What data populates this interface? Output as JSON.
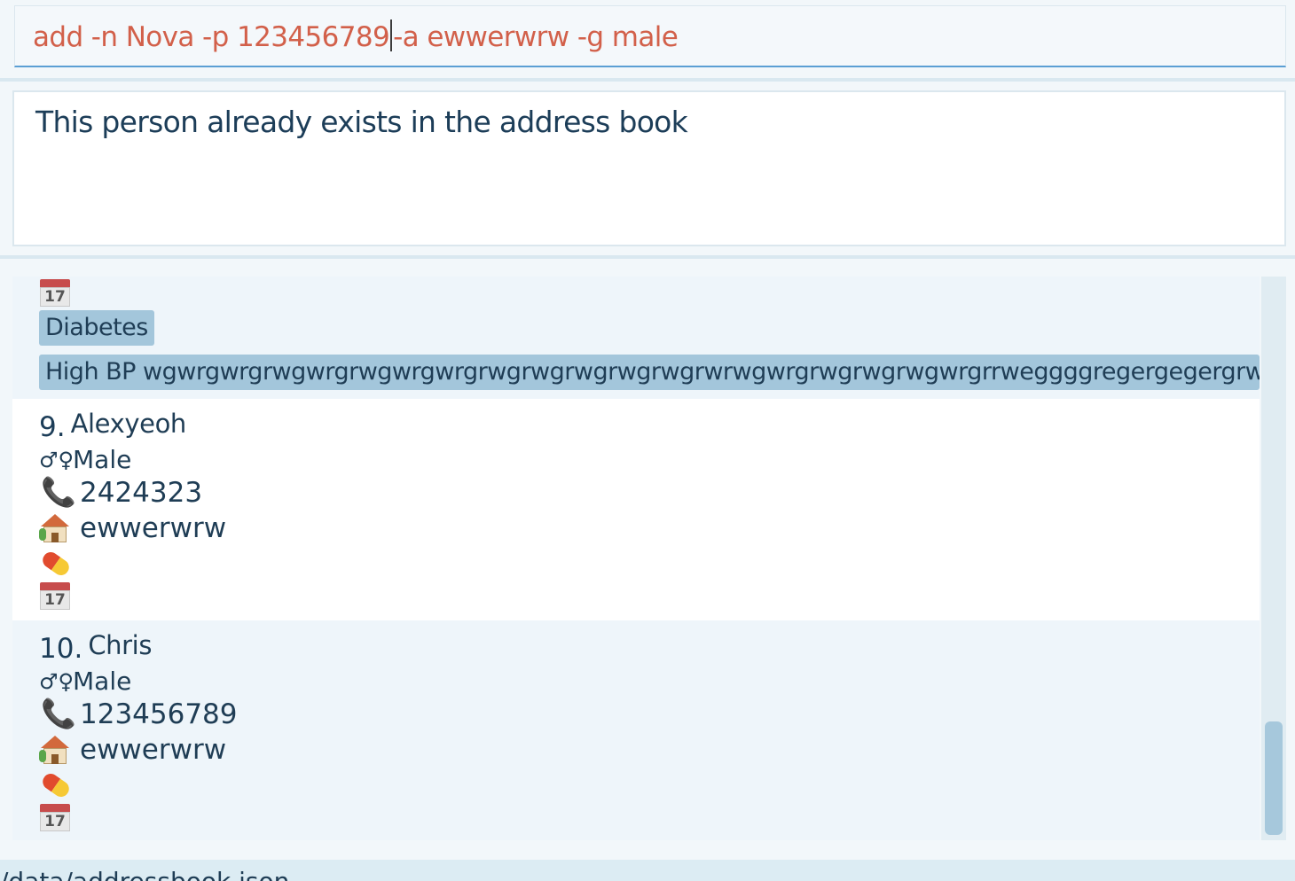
{
  "command_box": {
    "text_before_caret": "add -n Nova -p 123456789",
    "text_after_caret": "-a ewwerwrw -g male"
  },
  "result_display": {
    "message": "This person already exists in the address book"
  },
  "person_list": {
    "partial_card": {
      "tags": [
        "Diabetes",
        "High BP wgwrgwrgrwgwrgrwgwrgwrgrwgrwgrwgrwgrwgrwrwgwrgrwgrwgrwgwrgrrweggggregergegergrwgwrgwrgwrgwrgwrgwrgwrgw"
      ]
    },
    "cards": [
      {
        "index": "9.",
        "name": "Alexyeoh",
        "gender": "Male",
        "phone": "2424323",
        "address": "ewwerwrw",
        "medication": "",
        "appointment": ""
      },
      {
        "index": "10.",
        "name": "Chris",
        "gender": "Male",
        "phone": "123456789",
        "address": "ewwerwrw",
        "medication": "",
        "appointment": ""
      }
    ]
  },
  "icons": {
    "gender": "gender-icon",
    "phone": "phone-icon",
    "address": "house-icon",
    "medication": "pill-icon",
    "appointment": "calendar-icon"
  },
  "glyphs": {
    "gender": "♂♀",
    "phone": "📞",
    "calendar_day": "17"
  },
  "status_bar": {
    "path": "/data/addressbook.json"
  },
  "colors": {
    "command_text": "#d2604a",
    "tag_bg": "#a3c6db",
    "focus_underline": "#5b9fd4",
    "scroll_thumb": "#a6c8dc"
  }
}
